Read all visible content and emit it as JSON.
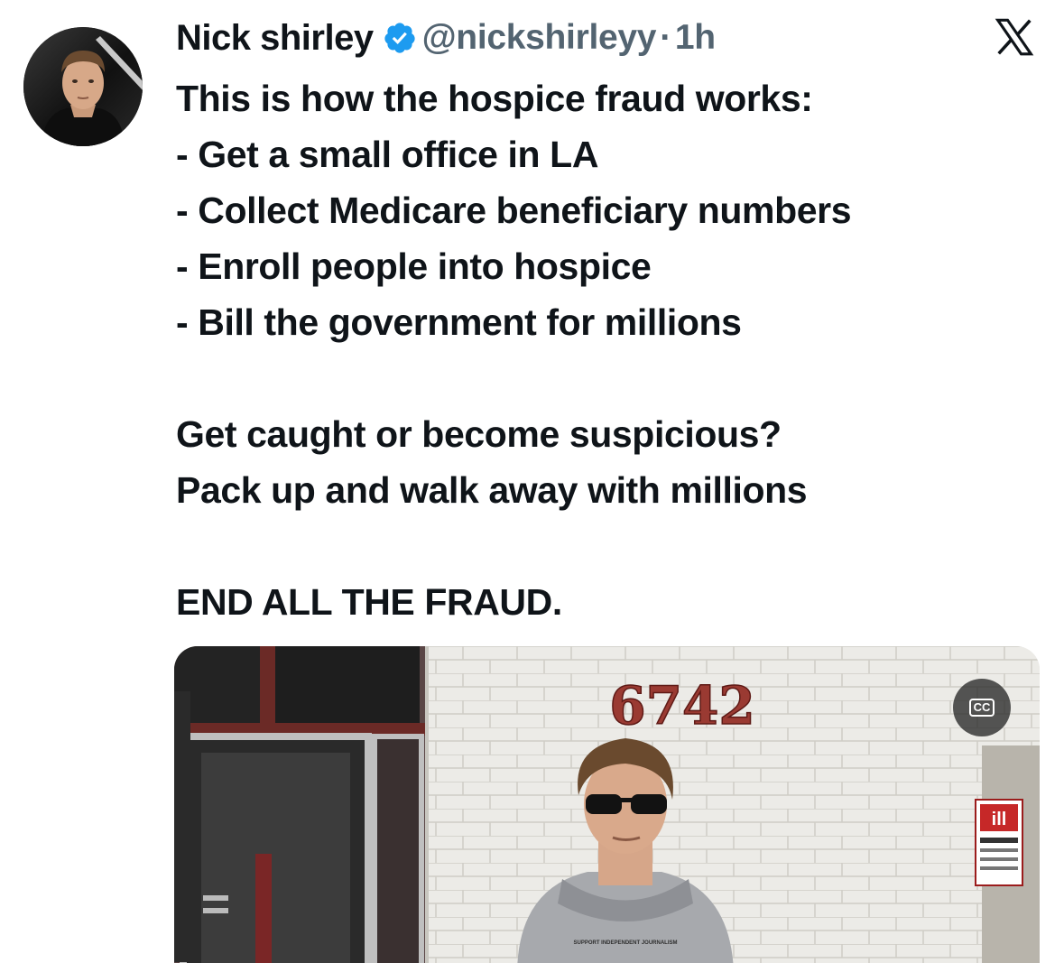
{
  "author": {
    "display_name": "Nick shirley",
    "handle": "@nickshirleyy",
    "separator": "·",
    "time": "1h",
    "verified_color": "#1d9bf0",
    "avatar_icon": "profile-photo"
  },
  "platform": {
    "logo_icon": "x-logo"
  },
  "tweet": {
    "lines": [
      "This is how the hospice fraud works:",
      "- Get a small office in LA",
      "- Collect Medicare beneficiary numbers",
      "- Enroll people into hospice",
      "- Bill the government for millions",
      "",
      "Get caught or become suspicious?",
      "Pack up and walk away with millions",
      "",
      "END ALL THE FRAUD."
    ]
  },
  "media": {
    "type": "video",
    "building_number": "6742",
    "sweatshirt_text": "SUPPORT INDEPENDENT JOURNALISM",
    "cc_label": "CC"
  }
}
